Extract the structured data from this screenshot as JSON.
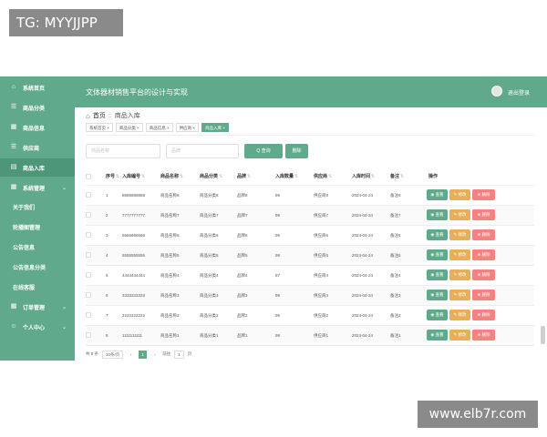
{
  "watermarks": {
    "top": "TG: MYYJJPP",
    "bottom": "www.elb7r.com"
  },
  "colors": {
    "primary": "#60aa8b",
    "edit": "#e6a23c",
    "delete": "#f56c6c"
  },
  "sidebar": {
    "items": [
      {
        "icon": "home-icon",
        "label": "系统首页"
      },
      {
        "icon": "list-icon",
        "label": "商品分类"
      },
      {
        "icon": "grid-icon",
        "label": "商品信息"
      },
      {
        "icon": "list-icon",
        "label": "供应商"
      },
      {
        "icon": "inbox-icon",
        "label": "商品入库"
      },
      {
        "icon": "grid-icon",
        "label": "系统管理"
      },
      {
        "label": "关于我们"
      },
      {
        "label": "轮播图管理"
      },
      {
        "label": "公告信息"
      },
      {
        "label": "公告信息分类"
      },
      {
        "label": "在线客服"
      },
      {
        "icon": "grid-icon",
        "label": "订单管理"
      },
      {
        "icon": "user-icon",
        "label": "个人中心"
      }
    ]
  },
  "header": {
    "title": "文体器材销售平台的设计与实现",
    "logout": "退出登录"
  },
  "breadcrumb": {
    "home": "首页",
    "current": "商品入库"
  },
  "tags": [
    "系统首页 ×",
    "商品分类 ×",
    "商品信息 ×",
    "供应商 ×",
    "商品入库 ×"
  ],
  "search": {
    "placeholder1": "商品名称",
    "placeholder2": "品牌",
    "search_label": "Q 查询",
    "delete_label": "删除"
  },
  "table": {
    "headers": [
      "序号",
      "入库编号",
      "商品名称",
      "商品分类",
      "品牌",
      "入库数量",
      "供应商",
      "入库时间",
      "备注",
      "操作"
    ],
    "rows": [
      [
        "1",
        "8888888888",
        "商品名称8",
        "商品分类8",
        "品牌8",
        "99",
        "供应商8",
        "2024-04-24",
        "备注8"
      ],
      [
        "2",
        "7777777777",
        "商品名称7",
        "商品分类7",
        "品牌7",
        "99",
        "供应商7",
        "2024-04-24",
        "备注7"
      ],
      [
        "3",
        "6666666666",
        "商品名称6",
        "商品分类6",
        "品牌6",
        "99",
        "供应商6",
        "2024-04-24",
        "备注6"
      ],
      [
        "4",
        "5555555555",
        "商品名称5",
        "商品分类5",
        "品牌5",
        "99",
        "供应商5",
        "2024-04-24",
        "备注5"
      ],
      [
        "5",
        "4444444444",
        "商品名称4",
        "商品分类4",
        "品牌4",
        "97",
        "供应商4",
        "2024-04-24",
        "备注4"
      ],
      [
        "6",
        "3333333333",
        "商品名称3",
        "商品分类3",
        "品牌3",
        "99",
        "供应商3",
        "2024-04-24",
        "备注3"
      ],
      [
        "7",
        "2222222222",
        "商品名称2",
        "商品分类2",
        "品牌2",
        "99",
        "供应商2",
        "2024-04-24",
        "备注2"
      ],
      [
        "8",
        "1111111111",
        "商品名称1",
        "商品分类1",
        "品牌1",
        "99",
        "供应商1",
        "2024-04-24",
        "备注1"
      ]
    ],
    "actions": {
      "view": "查看",
      "edit": "修改",
      "delete": "删除"
    }
  },
  "pagination": {
    "total": "共 8 条",
    "page_size": "10条/页",
    "current_page": "1",
    "goto": "前往",
    "goto_value": "1",
    "page_word": "页"
  }
}
